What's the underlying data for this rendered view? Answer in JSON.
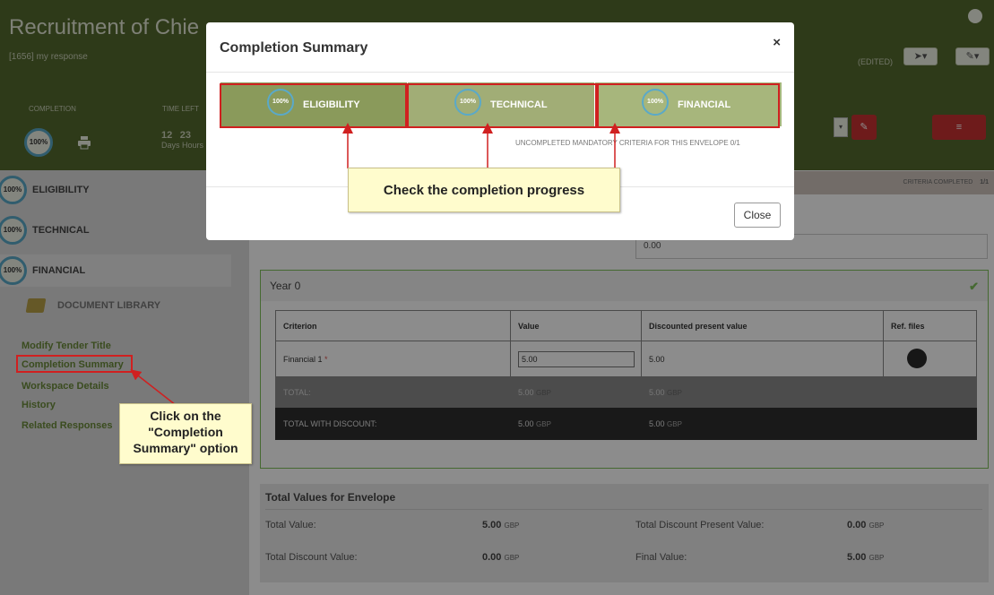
{
  "header": {
    "title": "Recruitment of Chie",
    "subtitle": "[1656] my response",
    "completion_label": "COMPLETION",
    "time_left_label": "TIME LEFT",
    "completion_pct": "100%",
    "time_days": "12",
    "time_hours": "23",
    "time_units": "Days Hours",
    "edited": "(EDITED)"
  },
  "sidebar": {
    "envelopes": [
      {
        "pct": "100%",
        "label": "ELIGIBILITY"
      },
      {
        "pct": "100%",
        "label": "TECHNICAL"
      },
      {
        "pct": "100%",
        "label": "FINANCIAL"
      }
    ],
    "document_library": "DOCUMENT LIBRARY",
    "links": [
      "Modify Tender Title",
      "Completion Summary",
      "Workspace Details",
      "History",
      "Related Responses"
    ]
  },
  "main": {
    "criteria_completed": "CRITERIA COMPLETED",
    "criteria_count": "1/1",
    "discount_field": "0.00",
    "year_title": "Year 0",
    "table": {
      "headers": [
        "Criterion",
        "Value",
        "Discounted present value",
        "Ref. files"
      ],
      "row": {
        "criterion": "Financial 1",
        "required": "*",
        "value": "5.00",
        "discounted": "5.00"
      },
      "total_label": "TOTAL:",
      "total_value": "5.00",
      "total_discounted": "5.00",
      "total_disc_label": "TOTAL WITH DISCOUNT:",
      "total_disc_value": "5.00",
      "total_disc_discounted": "5.00",
      "currency": "GBP"
    },
    "totals": {
      "heading": "Total Values for Envelope",
      "total_value_label": "Total Value:",
      "total_value": "5.00",
      "total_discount_value_label": "Total Discount Value:",
      "total_discount_value": "0.00",
      "total_discount_present_label": "Total Discount Present Value:",
      "total_discount_present": "0.00",
      "final_value_label": "Final Value:",
      "final_value": "5.00",
      "currency": "GBP"
    }
  },
  "modal": {
    "title": "Completion Summary",
    "close_x": "×",
    "segments": [
      {
        "pct": "100%",
        "label": "ELIGIBILITY"
      },
      {
        "pct": "100%",
        "label": "TECHNICAL"
      },
      {
        "pct": "100%",
        "label": "FINANCIAL"
      }
    ],
    "note": "UNCOMPLETED MANDATORY CRITERIA FOR THIS ENVELOPE 0/1",
    "close_button": "Close"
  },
  "annotations": {
    "progress_callout": "Check the completion progress",
    "click_callout": "Click on the \"Completion Summary\" option"
  },
  "colors": {
    "header": "#556b2f",
    "segment": "#8a9a5b",
    "danger": "#c83232",
    "success": "#7fbf5a"
  }
}
